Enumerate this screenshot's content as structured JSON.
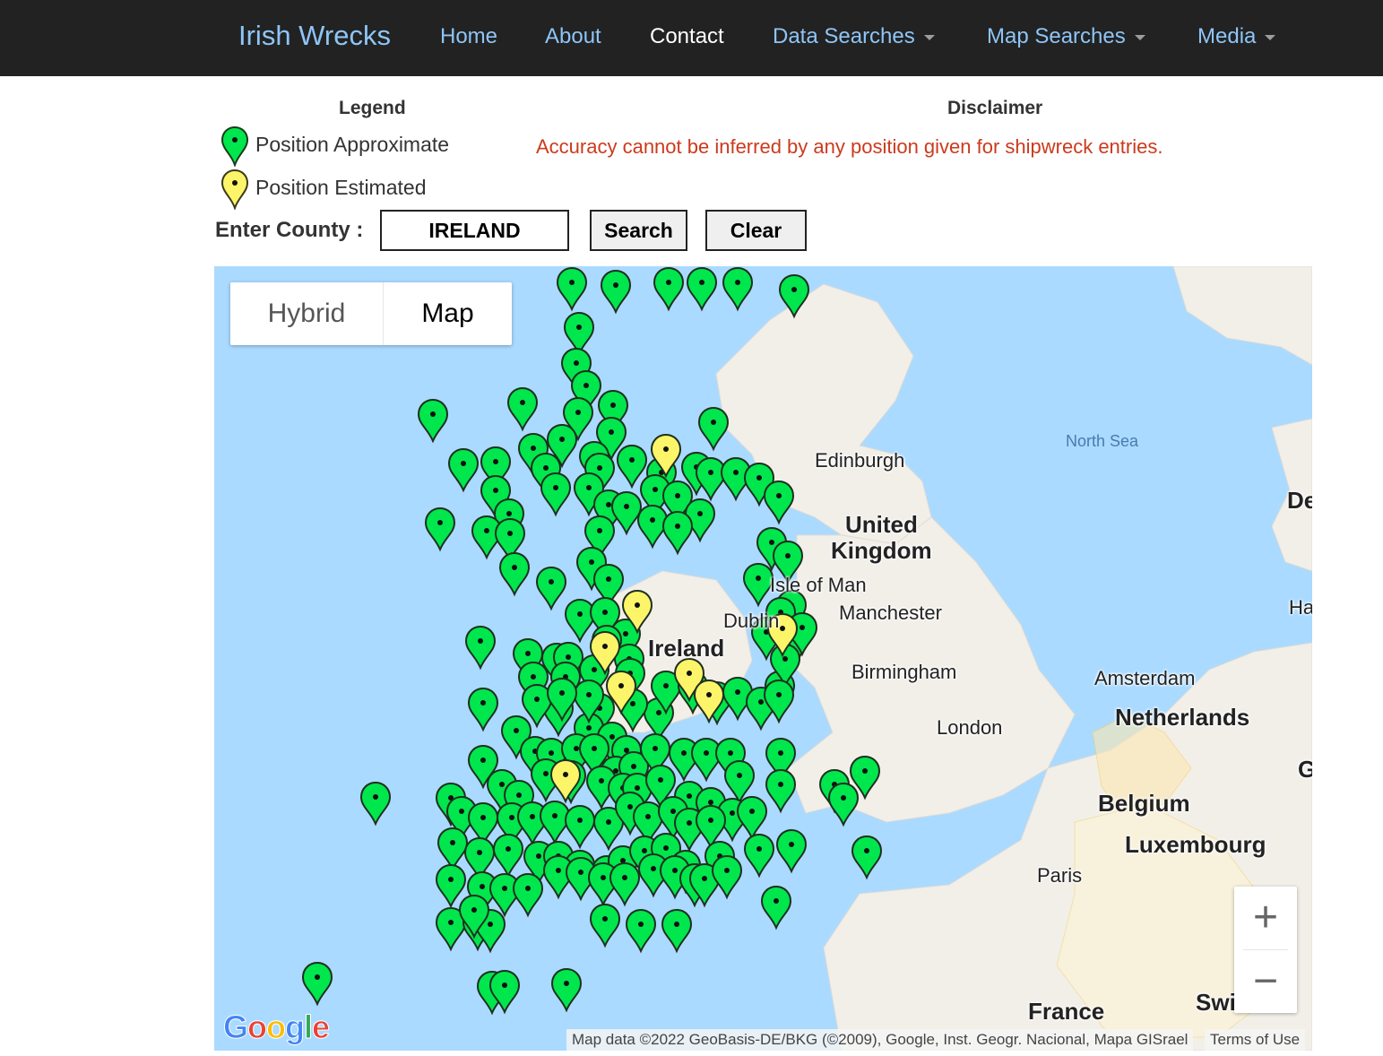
{
  "navbar": {
    "brand": "Irish Wrecks",
    "links": [
      {
        "label": "Home",
        "active": false,
        "dropdown": false
      },
      {
        "label": "About",
        "active": false,
        "dropdown": false
      },
      {
        "label": "Contact",
        "active": true,
        "dropdown": false
      },
      {
        "label": "Data Searches",
        "active": false,
        "dropdown": true
      },
      {
        "label": "Map Searches",
        "active": false,
        "dropdown": true
      },
      {
        "label": "Media",
        "active": false,
        "dropdown": true
      }
    ]
  },
  "legend": {
    "title": "Legend",
    "items": [
      {
        "label": "Position Approximate",
        "marker_color": "#00e64d"
      },
      {
        "label": "Position Estimated",
        "marker_color": "#fdf569"
      }
    ]
  },
  "disclaimer": {
    "title": "Disclaimer",
    "text": "Accuracy cannot be inferred by any position given for shipwreck entries."
  },
  "search": {
    "label": "Enter County :",
    "value": "IRELAND",
    "search_button": "Search",
    "clear_button": "Clear"
  },
  "map": {
    "type_options": [
      "Hybrid",
      "Map"
    ],
    "selected_type": "Map",
    "zoom_in": "+",
    "zoom_out": "−",
    "logo": "Google",
    "attribution": "Map data ©2022 GeoBasis-DE/BKG (©2009), Google, Inst. Geogr. Nacional, Mapa GISrael",
    "terms": "Terms of Use",
    "place_labels": {
      "north_sea": "North Sea",
      "edinburgh": "Edinburgh",
      "uk_line1": "United",
      "uk_line2": "Kingdom",
      "isle_of_man": "Isle of Man",
      "manchester": "Manchester",
      "dublin": "Dublin",
      "ireland": "Ireland",
      "birmingham": "Birmingham",
      "london": "London",
      "amsterdam": "Amsterdam",
      "netherlands": "Netherlands",
      "belgium": "Belgium",
      "luxembourg": "Luxembourg",
      "paris": "Paris",
      "france": "France",
      "denmark_partial": "De",
      "hamburg_partial": "Ha",
      "germany_partial": "G",
      "switzerland_partial": "Swi"
    },
    "colors": {
      "water": "#aadaff",
      "land": "#f2efe9",
      "green_marker": "#00e64d",
      "yellow_marker": "#fdf569"
    }
  }
}
